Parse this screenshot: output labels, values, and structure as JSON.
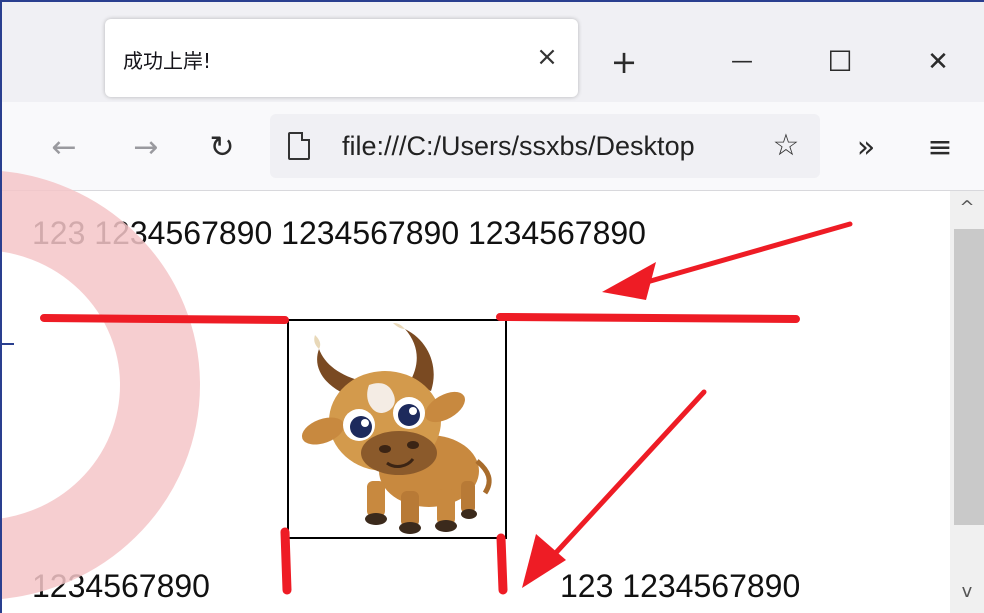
{
  "tab": {
    "title": "成功上岸!",
    "close_label": "×"
  },
  "window_controls": {
    "new_tab": "+",
    "minimize": "—",
    "maximize": "☐",
    "close": "✕"
  },
  "nav": {
    "back": "←",
    "forward": "→",
    "reload": "↻",
    "overflow": "»",
    "menu": "≡"
  },
  "urlbar": {
    "url": "file:///C:/Users/ssxbs/Desktop",
    "star": "☆"
  },
  "page": {
    "line1": "123 1234567890 1234567890 1234567890",
    "line2_left": "1234567890",
    "line2_right": "123 1234567890",
    "image_alt": "cartoon-bull"
  },
  "scrollbar": {
    "up": "^",
    "down": "v"
  },
  "annotation_color": "#ee1c25",
  "decor_color": "#f4c6c8"
}
